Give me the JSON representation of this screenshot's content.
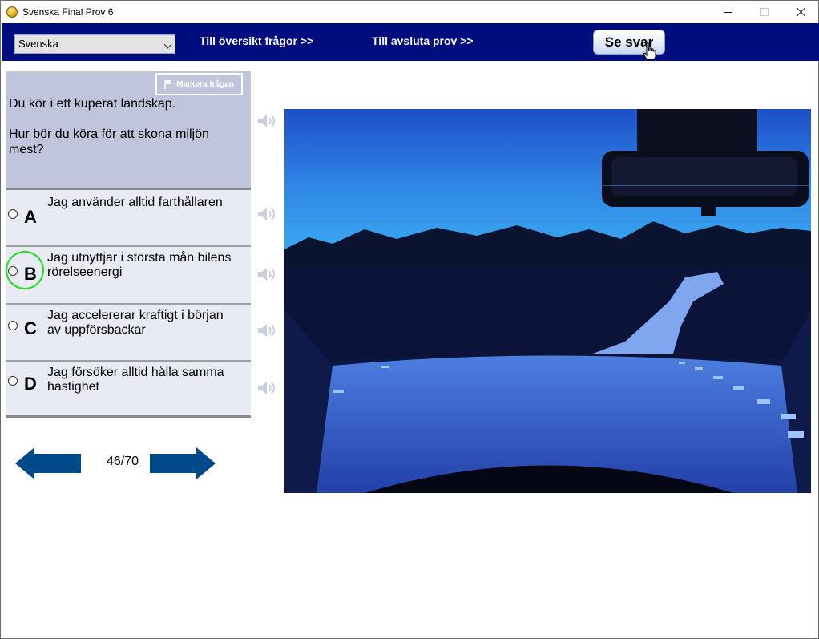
{
  "window": {
    "title": "Svenska Final Prov 6"
  },
  "toolbar": {
    "language_selected": "Svenska",
    "overview_link": "Till översikt frågor >>",
    "finish_link": "Till avsluta prov  >>",
    "see_answer_label": "Se svar"
  },
  "question": {
    "mark_label": "Markera frågan",
    "line1": "Du kör i ett kuperat landskap.",
    "line2": "Hur bör du köra för att skona miljön mest?"
  },
  "options": [
    {
      "letter": "A",
      "text": "Jag använder alltid farthållaren"
    },
    {
      "letter": "B",
      "text": "Jag utnyttjar i största mån bilens rörelseenergi"
    },
    {
      "letter": "C",
      "text": "Jag accelererar kraftigt i början av uppförsbackar"
    },
    {
      "letter": "D",
      "text": "Jag försöker alltid hålla samma hastighet"
    }
  ],
  "navigation": {
    "prev_label": "Föregående",
    "next_label": "Nästa",
    "counter": "46/70"
  },
  "colors": {
    "nav_bg": "#000d7f",
    "question_bg": "#c0c5db",
    "option_bg": "#e8eaf4",
    "arrow_blue": "#004a8a",
    "highlight_ring": "#22dd22"
  }
}
